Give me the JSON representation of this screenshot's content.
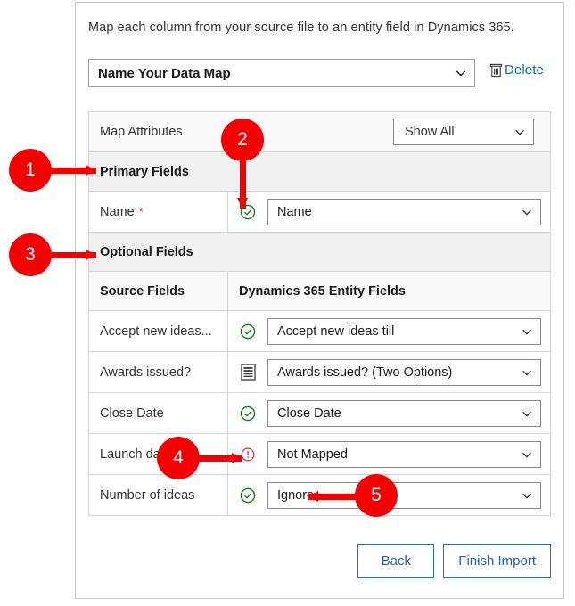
{
  "intro": "Map each column from your source file to an entity field in Dynamics 365.",
  "map_name": {
    "value": "Name Your Data Map",
    "chevron_icon": "chevron-down-icon",
    "delete_label": "Delete",
    "delete_icon": "trash-icon"
  },
  "map_attributes": {
    "label": "Map Attributes",
    "filter_value": "Show All",
    "filter_chevron_icon": "chevron-down-icon"
  },
  "sections": {
    "primary": "Primary Fields",
    "optional": "Optional Fields"
  },
  "columns": {
    "source": "Source Fields",
    "target": "Dynamics 365 Entity Fields"
  },
  "primary_rows": [
    {
      "source": "Name",
      "required_marker": "*",
      "status_icon": "check-circle-icon",
      "status": "mapped",
      "target": "Name"
    }
  ],
  "optional_rows": [
    {
      "source": "Accept new ideas...",
      "status_icon": "check-circle-icon",
      "status": "mapped",
      "target": "Accept new ideas till"
    },
    {
      "source": "Awards issued?",
      "status_icon": "option-set-list-icon",
      "status": "option-set",
      "target": "Awards issued? (Two Options)"
    },
    {
      "source": "Close Date",
      "status_icon": "check-circle-icon",
      "status": "mapped",
      "target": "Close Date"
    },
    {
      "source": "Launch da",
      "status_icon": "error-circle-icon",
      "status": "not-mapped",
      "target": "Not Mapped"
    },
    {
      "source": "Number of ideas",
      "status_icon": "check-circle-icon",
      "status": "ignored",
      "target": "Ignore"
    }
  ],
  "footer": {
    "back_label": "Back",
    "finish_label": "Finish Import"
  },
  "callouts": [
    {
      "number": "1"
    },
    {
      "number": "2"
    },
    {
      "number": "3"
    },
    {
      "number": "4"
    },
    {
      "number": "5"
    }
  ],
  "colors": {
    "callout_red": "#f40000",
    "link_blue": "#1668b8",
    "button_blue": "#1d64ad",
    "success_green": "#107c10",
    "error_red": "#d13438"
  }
}
